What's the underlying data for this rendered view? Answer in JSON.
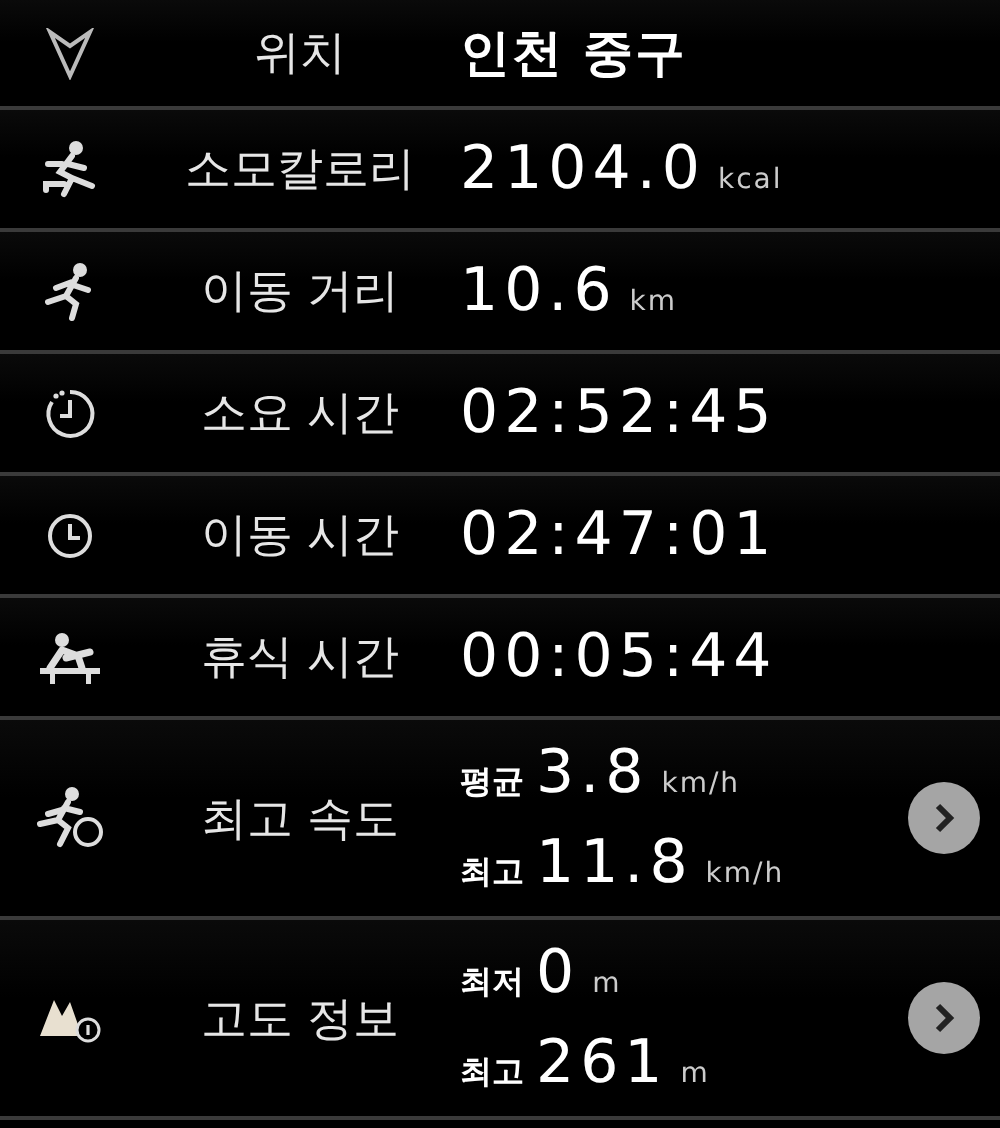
{
  "rows": [
    {
      "kind": "location",
      "label": "위치",
      "value": "인천 중구"
    },
    {
      "kind": "single",
      "label": "소모칼로리",
      "value": "2104.0",
      "unit": "kcal"
    },
    {
      "kind": "single",
      "label": "이동 거리",
      "value": "10.6",
      "unit": "km"
    },
    {
      "kind": "single",
      "label": "소요 시간",
      "value": "02:52:45"
    },
    {
      "kind": "single",
      "label": "이동 시간",
      "value": "02:47:01"
    },
    {
      "kind": "single",
      "label": "휴식 시간",
      "value": "00:05:44"
    },
    {
      "kind": "dual",
      "label": "최고 속도",
      "lines": [
        {
          "prefix": "평균",
          "value": "3.8",
          "unit": "km/h"
        },
        {
          "prefix": "최고",
          "value": "11.8",
          "unit": "km/h"
        }
      ]
    },
    {
      "kind": "dual",
      "label": "고도 정보",
      "lines": [
        {
          "prefix": "최저",
          "value": "0",
          "unit": "m"
        },
        {
          "prefix": "최고",
          "value": "261",
          "unit": "m"
        }
      ]
    }
  ]
}
